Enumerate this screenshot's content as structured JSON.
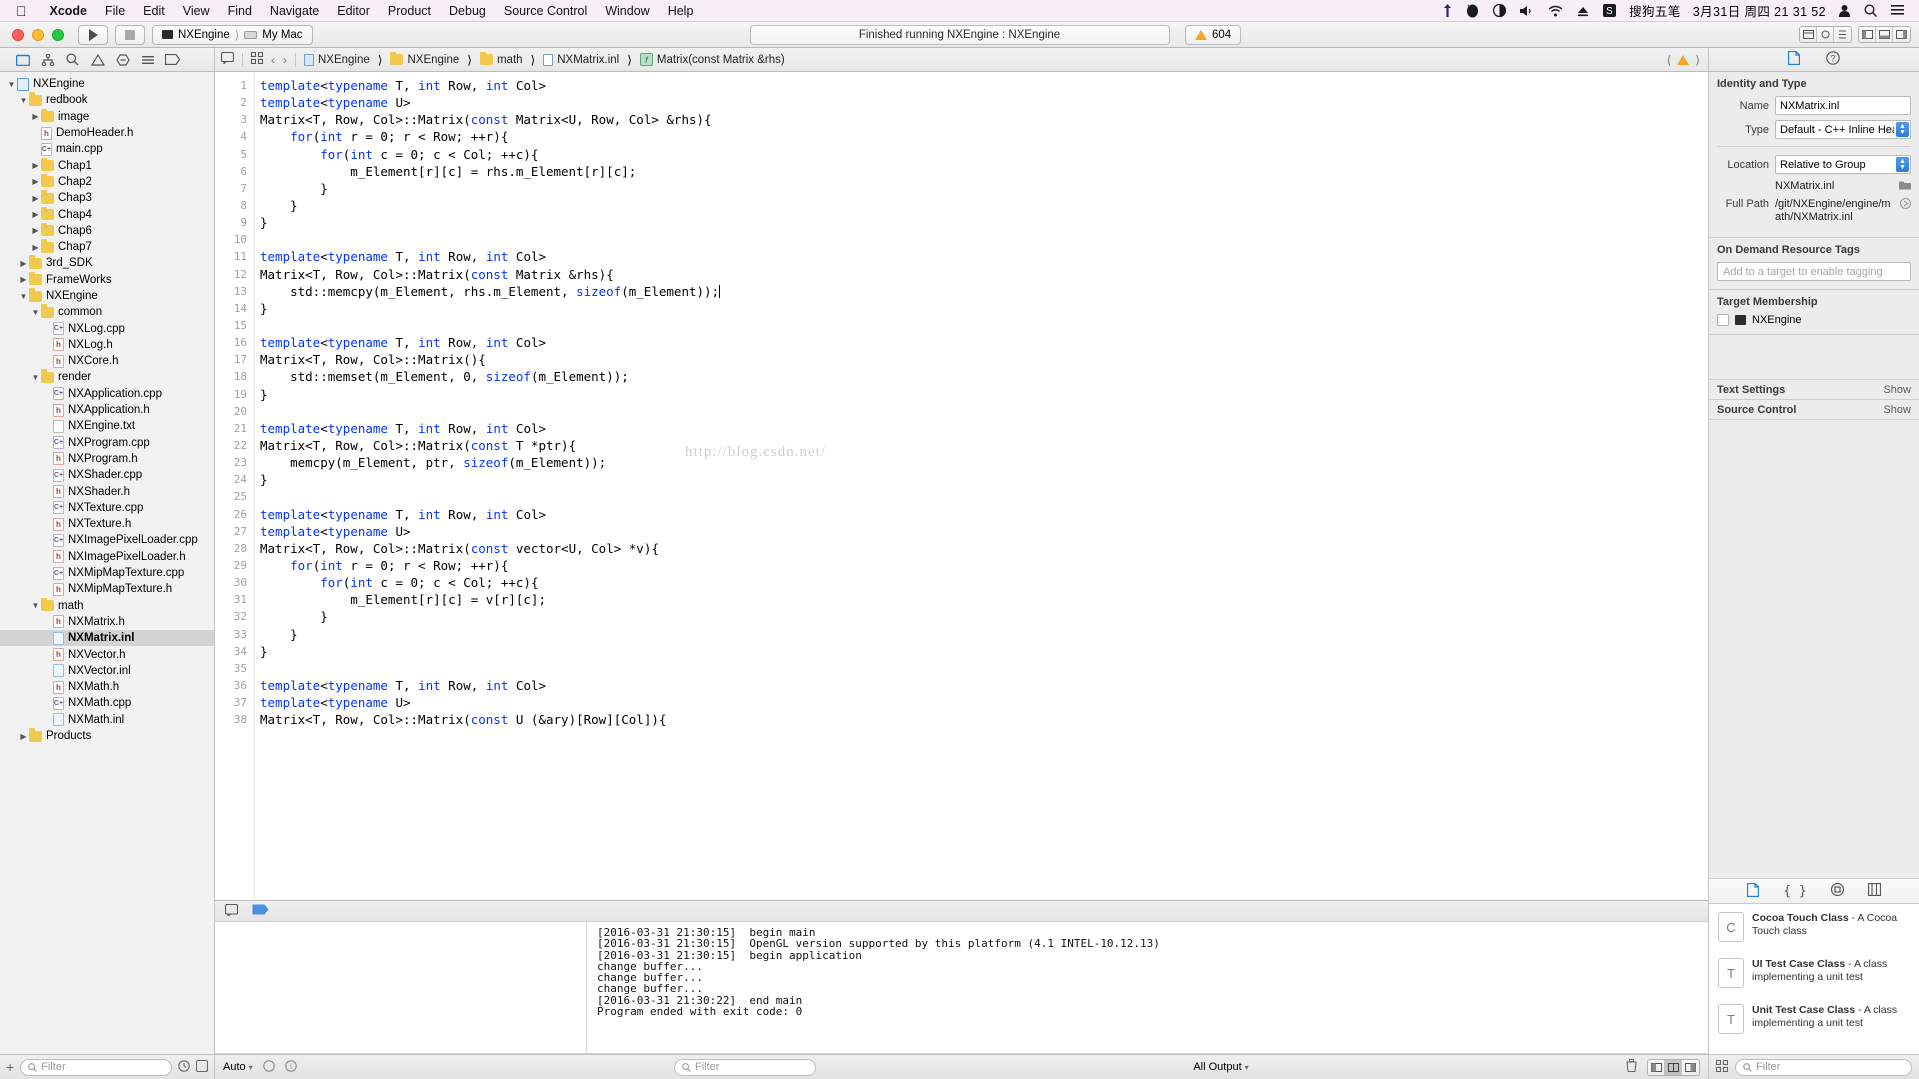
{
  "menubar": {
    "apple": "apple-logo",
    "items": [
      "Xcode",
      "File",
      "Edit",
      "View",
      "Find",
      "Navigate",
      "Editor",
      "Product",
      "Debug",
      "Source Control",
      "Window",
      "Help"
    ],
    "ime": "搜狗五笔",
    "clock": "3月31日 周四 21 31 52",
    "status_icons": [
      "upload-icon",
      "qq-icon",
      "contrast-icon",
      "volume-icon",
      "wifi-icon",
      "eject-icon",
      "sogou-icon",
      "user-icon",
      "spotlight-search-icon",
      "notification-center-icon"
    ]
  },
  "toolbar": {
    "run_label": "run-button",
    "stop_label": "stop-button",
    "scheme_target": "NXEngine",
    "scheme_device": "My Mac",
    "status_text": "Finished running NXEngine : NXEngine",
    "warning_count": "604"
  },
  "breadcrumb": [
    {
      "label": "NXEngine",
      "icon": "project-icon"
    },
    {
      "label": "NXEngine",
      "icon": "folder-icon"
    },
    {
      "label": "math",
      "icon": "folder-icon"
    },
    {
      "label": "NXMatrix.inl",
      "icon": "file-icon"
    },
    {
      "label": "Matrix(const Matrix &rhs)",
      "icon": "function-icon"
    }
  ],
  "navigator": {
    "tab_icons": [
      "folder-navigator-icon",
      "source-control-icon",
      "search-icon",
      "issue-icon",
      "test-icon",
      "debug-icon",
      "breakpoint-icon",
      "report-icon"
    ],
    "filter_placeholder": "Filter",
    "tree": [
      {
        "label": "NXEngine",
        "depth": 0,
        "twisty": "open",
        "icon": "project",
        "bold": false
      },
      {
        "label": "redbook",
        "depth": 1,
        "twisty": "open",
        "icon": "folder"
      },
      {
        "label": "image",
        "depth": 2,
        "twisty": "closed",
        "icon": "folder"
      },
      {
        "label": "DemoHeader.h",
        "depth": 2,
        "twisty": "none",
        "icon": "h"
      },
      {
        "label": "main.cpp",
        "depth": 2,
        "twisty": "none",
        "icon": "cpp"
      },
      {
        "label": "Chap1",
        "depth": 2,
        "twisty": "closed",
        "icon": "folder"
      },
      {
        "label": "Chap2",
        "depth": 2,
        "twisty": "closed",
        "icon": "folder"
      },
      {
        "label": "Chap3",
        "depth": 2,
        "twisty": "closed",
        "icon": "folder"
      },
      {
        "label": "Chap4",
        "depth": 2,
        "twisty": "closed",
        "icon": "folder"
      },
      {
        "label": "Chap6",
        "depth": 2,
        "twisty": "closed",
        "icon": "folder"
      },
      {
        "label": "Chap7",
        "depth": 2,
        "twisty": "closed",
        "icon": "folder"
      },
      {
        "label": "3rd_SDK",
        "depth": 1,
        "twisty": "closed",
        "icon": "folder"
      },
      {
        "label": "FrameWorks",
        "depth": 1,
        "twisty": "closed",
        "icon": "folder"
      },
      {
        "label": "NXEngine",
        "depth": 1,
        "twisty": "open",
        "icon": "folder"
      },
      {
        "label": "common",
        "depth": 2,
        "twisty": "open",
        "icon": "folder"
      },
      {
        "label": "NXLog.cpp",
        "depth": 3,
        "twisty": "none",
        "icon": "cpp"
      },
      {
        "label": "NXLog.h",
        "depth": 3,
        "twisty": "none",
        "icon": "h"
      },
      {
        "label": "NXCore.h",
        "depth": 3,
        "twisty": "none",
        "icon": "h"
      },
      {
        "label": "render",
        "depth": 2,
        "twisty": "open",
        "icon": "folder"
      },
      {
        "label": "NXApplication.cpp",
        "depth": 3,
        "twisty": "none",
        "icon": "cpp"
      },
      {
        "label": "NXApplication.h",
        "depth": 3,
        "twisty": "none",
        "icon": "h"
      },
      {
        "label": "NXEngine.txt",
        "depth": 3,
        "twisty": "none",
        "icon": "txt"
      },
      {
        "label": "NXProgram.cpp",
        "depth": 3,
        "twisty": "none",
        "icon": "cpp"
      },
      {
        "label": "NXProgram.h",
        "depth": 3,
        "twisty": "none",
        "icon": "h"
      },
      {
        "label": "NXShader.cpp",
        "depth": 3,
        "twisty": "none",
        "icon": "cpp"
      },
      {
        "label": "NXShader.h",
        "depth": 3,
        "twisty": "none",
        "icon": "h"
      },
      {
        "label": "NXTexture.cpp",
        "depth": 3,
        "twisty": "none",
        "icon": "cpp"
      },
      {
        "label": "NXTexture.h",
        "depth": 3,
        "twisty": "none",
        "icon": "h"
      },
      {
        "label": "NXImagePixelLoader.cpp",
        "depth": 3,
        "twisty": "none",
        "icon": "cpp"
      },
      {
        "label": "NXImagePixelLoader.h",
        "depth": 3,
        "twisty": "none",
        "icon": "h"
      },
      {
        "label": "NXMipMapTexture.cpp",
        "depth": 3,
        "twisty": "none",
        "icon": "cpp"
      },
      {
        "label": "NXMipMapTexture.h",
        "depth": 3,
        "twisty": "none",
        "icon": "h"
      },
      {
        "label": "math",
        "depth": 2,
        "twisty": "open",
        "icon": "folder"
      },
      {
        "label": "NXMatrix.h",
        "depth": 3,
        "twisty": "none",
        "icon": "h"
      },
      {
        "label": "NXMatrix.inl",
        "depth": 3,
        "twisty": "none",
        "icon": "inl",
        "selected": true,
        "bold": true
      },
      {
        "label": "NXVector.h",
        "depth": 3,
        "twisty": "none",
        "icon": "h"
      },
      {
        "label": "NXVector.inl",
        "depth": 3,
        "twisty": "none",
        "icon": "inl"
      },
      {
        "label": "NXMath.h",
        "depth": 3,
        "twisty": "none",
        "icon": "h"
      },
      {
        "label": "NXMath.cpp",
        "depth": 3,
        "twisty": "none",
        "icon": "cpp"
      },
      {
        "label": "NXMath.inl",
        "depth": 3,
        "twisty": "none",
        "icon": "inl"
      },
      {
        "label": "Products",
        "depth": 1,
        "twisty": "closed",
        "icon": "folder"
      }
    ]
  },
  "code": {
    "first_line": 1,
    "lines": [
      [
        [
          "template",
          "kw"
        ],
        [
          "<",
          ""
        ],
        [
          "typename",
          "kw"
        ],
        [
          " T, ",
          ""
        ],
        [
          "int",
          "kw"
        ],
        [
          " Row, ",
          ""
        ],
        [
          "int",
          "kw"
        ],
        [
          " Col>",
          ""
        ]
      ],
      [
        [
          "template",
          "kw"
        ],
        [
          "<",
          ""
        ],
        [
          "typename",
          "kw"
        ],
        [
          " U>",
          ""
        ]
      ],
      [
        [
          "Matrix<T, Row, Col>::Matrix(",
          ""
        ],
        [
          "const",
          "kw"
        ],
        [
          " Matrix<U, Row, Col> &rhs){",
          ""
        ]
      ],
      [
        [
          "    ",
          ""
        ],
        [
          "for",
          "kw"
        ],
        [
          "(",
          ""
        ],
        [
          "int",
          "kw"
        ],
        [
          " r = 0; r < Row; ++r){",
          ""
        ]
      ],
      [
        [
          "        ",
          ""
        ],
        [
          "for",
          "kw"
        ],
        [
          "(",
          ""
        ],
        [
          "int",
          "kw"
        ],
        [
          " c = 0; c < Col; ++c){",
          ""
        ]
      ],
      [
        [
          "            m_Element[r][c] = rhs.m_Element[r][c];",
          ""
        ]
      ],
      [
        [
          "        }",
          ""
        ]
      ],
      [
        [
          "    }",
          ""
        ]
      ],
      [
        [
          "}",
          ""
        ]
      ],
      [
        [
          "",
          ""
        ]
      ],
      [
        [
          "template",
          "kw"
        ],
        [
          "<",
          ""
        ],
        [
          "typename",
          "kw"
        ],
        [
          " T, ",
          ""
        ],
        [
          "int",
          "kw"
        ],
        [
          " Row, ",
          ""
        ],
        [
          "int",
          "kw"
        ],
        [
          " Col>",
          ""
        ]
      ],
      [
        [
          "Matrix<T, Row, Col>::Matrix(",
          ""
        ],
        [
          "const",
          "kw"
        ],
        [
          " Matrix &rhs){",
          ""
        ]
      ],
      [
        [
          "    std::memcpy(m_Element, rhs.m_Element, ",
          ""
        ],
        [
          "sizeof",
          "kw"
        ],
        [
          "(m_Element));",
          ""
        ]
      ],
      [
        [
          "}",
          ""
        ]
      ],
      [
        [
          "",
          ""
        ]
      ],
      [
        [
          "template",
          "kw"
        ],
        [
          "<",
          ""
        ],
        [
          "typename",
          "kw"
        ],
        [
          " T, ",
          ""
        ],
        [
          "int",
          "kw"
        ],
        [
          " Row, ",
          ""
        ],
        [
          "int",
          "kw"
        ],
        [
          " Col>",
          ""
        ]
      ],
      [
        [
          "Matrix<T, Row, Col>::Matrix(){",
          ""
        ]
      ],
      [
        [
          "    std::memset(m_Element, 0, ",
          ""
        ],
        [
          "sizeof",
          "kw"
        ],
        [
          "(m_Element));",
          ""
        ]
      ],
      [
        [
          "}",
          ""
        ]
      ],
      [
        [
          "",
          ""
        ]
      ],
      [
        [
          "template",
          "kw"
        ],
        [
          "<",
          ""
        ],
        [
          "typename",
          "kw"
        ],
        [
          " T, ",
          ""
        ],
        [
          "int",
          "kw"
        ],
        [
          " Row, ",
          ""
        ],
        [
          "int",
          "kw"
        ],
        [
          " Col>",
          ""
        ]
      ],
      [
        [
          "Matrix<T, Row, Col>::Matrix(",
          ""
        ],
        [
          "const",
          "kw"
        ],
        [
          " T *ptr){",
          ""
        ]
      ],
      [
        [
          "    memcpy(m_Element, ptr, ",
          ""
        ],
        [
          "sizeof",
          "kw"
        ],
        [
          "(m_Element));",
          ""
        ]
      ],
      [
        [
          "}",
          ""
        ]
      ],
      [
        [
          "",
          ""
        ]
      ],
      [
        [
          "template",
          "kw"
        ],
        [
          "<",
          ""
        ],
        [
          "typename",
          "kw"
        ],
        [
          " T, ",
          ""
        ],
        [
          "int",
          "kw"
        ],
        [
          " Row, ",
          ""
        ],
        [
          "int",
          "kw"
        ],
        [
          " Col>",
          ""
        ]
      ],
      [
        [
          "template",
          "kw"
        ],
        [
          "<",
          ""
        ],
        [
          "typename",
          "kw"
        ],
        [
          " U>",
          ""
        ]
      ],
      [
        [
          "Matrix<T, Row, Col>::Matrix(",
          ""
        ],
        [
          "const",
          "kw"
        ],
        [
          " vector<U, Col> *v){",
          ""
        ]
      ],
      [
        [
          "    ",
          ""
        ],
        [
          "for",
          "kw"
        ],
        [
          "(",
          ""
        ],
        [
          "int",
          "kw"
        ],
        [
          " r = 0; r < Row; ++r){",
          ""
        ]
      ],
      [
        [
          "        ",
          ""
        ],
        [
          "for",
          "kw"
        ],
        [
          "(",
          ""
        ],
        [
          "int",
          "kw"
        ],
        [
          " c = 0; c < Col; ++c){",
          ""
        ]
      ],
      [
        [
          "            m_Element[r][c] = v[r][c];",
          ""
        ]
      ],
      [
        [
          "        }",
          ""
        ]
      ],
      [
        [
          "    }",
          ""
        ]
      ],
      [
        [
          "}",
          ""
        ]
      ],
      [
        [
          "",
          ""
        ]
      ],
      [
        [
          "template",
          "kw"
        ],
        [
          "<",
          ""
        ],
        [
          "typename",
          "kw"
        ],
        [
          " T, ",
          ""
        ],
        [
          "int",
          "kw"
        ],
        [
          " Row, ",
          ""
        ],
        [
          "int",
          "kw"
        ],
        [
          " Col>",
          ""
        ]
      ],
      [
        [
          "template",
          "kw"
        ],
        [
          "<",
          ""
        ],
        [
          "typename",
          "kw"
        ],
        [
          " U>",
          ""
        ]
      ],
      [
        [
          "Matrix<T, Row, Col>::Matrix(",
          ""
        ],
        [
          "const",
          "kw"
        ],
        [
          " U (&ary)[Row][Col]){",
          ""
        ]
      ]
    ],
    "watermark": "http://blog.csdn.net/"
  },
  "console": {
    "lines": [
      "[2016-03-31 21:30:15]  begin main",
      "[2016-03-31 21:30:15]  OpenGL version supported by this platform (4.1 INTEL-10.12.13)",
      "[2016-03-31 21:30:15]  begin application",
      "change buffer...",
      "change buffer...",
      "change buffer...",
      "[2016-03-31 21:30:22]  end main",
      "Program ended with exit code: 0"
    ],
    "auto_label": "Auto",
    "filter_placeholder": "Filter",
    "output_label": "All Output"
  },
  "inspector": {
    "tabs": [
      "file-inspector-icon",
      "quick-help-icon"
    ],
    "identity": {
      "title": "Identity and Type",
      "name_label": "Name",
      "name_value": "NXMatrix.inl",
      "type_label": "Type",
      "type_value": "Default - C++ Inline Header",
      "location_label": "Location",
      "location_value": "Relative to Group",
      "location_file": "NXMatrix.inl",
      "fullpath_label": "Full Path",
      "fullpath_value": "/git/NXEngine/engine/math/NXMatrix.inl"
    },
    "odr": {
      "title": "On Demand Resource Tags",
      "placeholder": "Add to a target to enable tagging"
    },
    "target_membership": {
      "title": "Target Membership",
      "items": [
        {
          "label": "NXEngine",
          "checked": false
        }
      ]
    },
    "text_settings": {
      "title": "Text Settings",
      "action": "Show"
    },
    "source_control": {
      "title": "Source Control",
      "action": "Show"
    }
  },
  "library": {
    "tabs": [
      "file-template-library-icon",
      "code-snippet-library-icon",
      "object-library-icon",
      "media-library-icon"
    ],
    "items": [
      {
        "title": "Cocoa Touch Class",
        "desc": " - A Cocoa Touch class",
        "icon": "C"
      },
      {
        "title": "UI Test Case Class",
        "desc": " - A class implementing a unit test",
        "icon": "T"
      },
      {
        "title": "Unit Test Case Class",
        "desc": " - A class implementing a unit test",
        "icon": "T"
      }
    ],
    "filter_placeholder": "Filter"
  },
  "colors": {
    "keyword": "#0433ff",
    "accent": "#3b7dd8",
    "warning": "#f5a623",
    "folder": "#f2c94c"
  }
}
